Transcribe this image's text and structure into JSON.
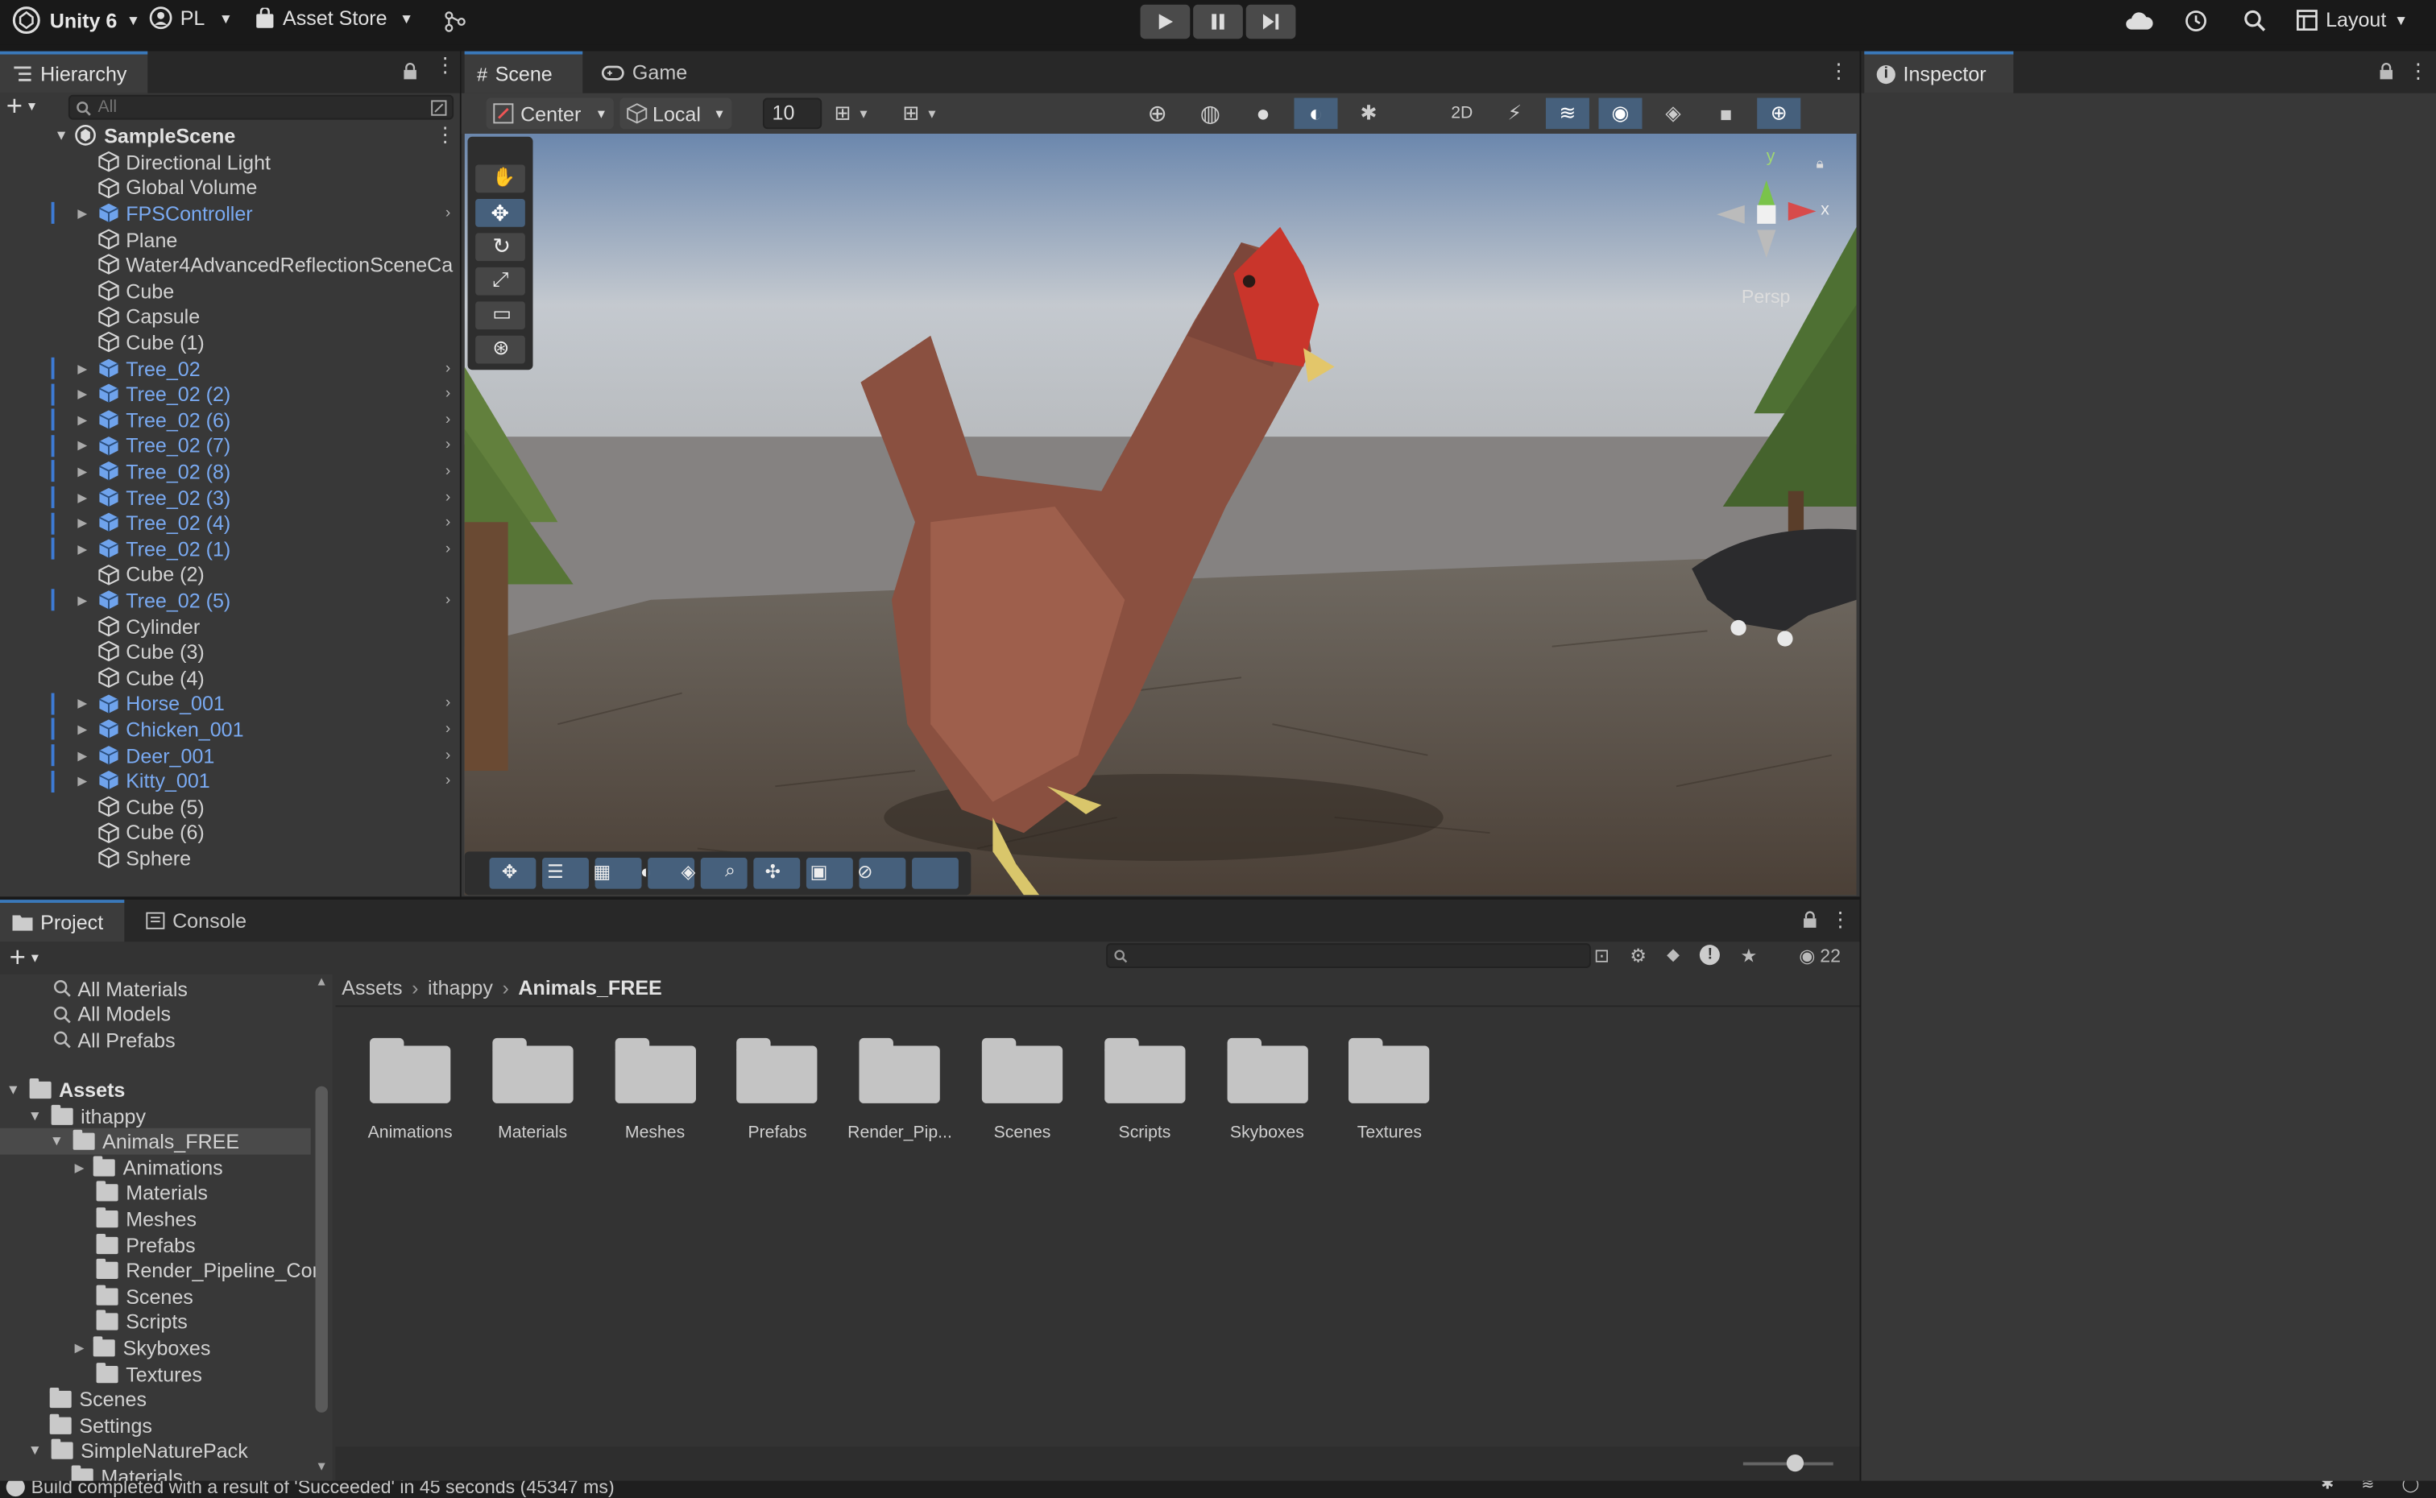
{
  "toolbar": {
    "app_name": "Unity 6",
    "account": "PL",
    "asset_store": "Asset Store",
    "layout": "Layout"
  },
  "hierarchy": {
    "tab": "Hierarchy",
    "search_placeholder": "All",
    "scene": "SampleScene",
    "items": [
      {
        "label": "Directional Light",
        "prefab": false,
        "expand": false
      },
      {
        "label": "Global Volume",
        "prefab": false,
        "expand": false
      },
      {
        "label": "FPSController",
        "prefab": true,
        "expand": true
      },
      {
        "label": "Plane",
        "prefab": false,
        "expand": false
      },
      {
        "label": "Water4AdvancedReflectionSceneCa",
        "prefab": false,
        "expand": false
      },
      {
        "label": "Cube",
        "prefab": false,
        "expand": false
      },
      {
        "label": "Capsule",
        "prefab": false,
        "expand": false
      },
      {
        "label": "Cube (1)",
        "prefab": false,
        "expand": false
      },
      {
        "label": "Tree_02",
        "prefab": true,
        "expand": true
      },
      {
        "label": "Tree_02 (2)",
        "prefab": true,
        "expand": true
      },
      {
        "label": "Tree_02 (6)",
        "prefab": true,
        "expand": true
      },
      {
        "label": "Tree_02 (7)",
        "prefab": true,
        "expand": true
      },
      {
        "label": "Tree_02 (8)",
        "prefab": true,
        "expand": true
      },
      {
        "label": "Tree_02 (3)",
        "prefab": true,
        "expand": true
      },
      {
        "label": "Tree_02 (4)",
        "prefab": true,
        "expand": true
      },
      {
        "label": "Tree_02 (1)",
        "prefab": true,
        "expand": true
      },
      {
        "label": "Cube (2)",
        "prefab": false,
        "expand": false
      },
      {
        "label": "Tree_02 (5)",
        "prefab": true,
        "expand": true
      },
      {
        "label": "Cylinder",
        "prefab": false,
        "expand": false
      },
      {
        "label": "Cube (3)",
        "prefab": false,
        "expand": false
      },
      {
        "label": "Cube (4)",
        "prefab": false,
        "expand": false
      },
      {
        "label": "Horse_001",
        "prefab": true,
        "expand": true
      },
      {
        "label": "Chicken_001",
        "prefab": true,
        "expand": true
      },
      {
        "label": "Deer_001",
        "prefab": true,
        "expand": true
      },
      {
        "label": "Kitty_001",
        "prefab": true,
        "expand": true
      },
      {
        "label": "Cube (5)",
        "prefab": false,
        "expand": false
      },
      {
        "label": "Cube (6)",
        "prefab": false,
        "expand": false
      },
      {
        "label": "Sphere",
        "prefab": false,
        "expand": false
      }
    ]
  },
  "scene_view": {
    "tab_scene": "Scene",
    "tab_game": "Game",
    "pivot": "Center",
    "space": "Local",
    "snap_value": "10",
    "gizmo_y": "y",
    "gizmo_x": "x",
    "persp": "Persp"
  },
  "inspector": {
    "tab": "Inspector"
  },
  "project": {
    "tab_project": "Project",
    "tab_console": "Console",
    "search_count": "22",
    "favorites": [
      "All Materials",
      "All Models",
      "All Prefabs"
    ],
    "tree": {
      "assets": "Assets",
      "ithappy": "ithappy",
      "animals": "Animals_FREE",
      "children": [
        "Animations",
        "Materials",
        "Meshes",
        "Prefabs",
        "Render_Pipeline_Con",
        "Scenes",
        "Scripts",
        "Skyboxes",
        "Textures"
      ],
      "scenes": "Scenes",
      "settings": "Settings",
      "nature": "SimpleNaturePack",
      "nature_child": "Materials"
    },
    "breadcrumb": [
      "Assets",
      "ithappy",
      "Animals_FREE"
    ],
    "folders": [
      "Animations",
      "Materials",
      "Meshes",
      "Prefabs",
      "Render_Pip...",
      "Scenes",
      "Scripts",
      "Skyboxes",
      "Textures"
    ]
  },
  "status": {
    "message": "Build completed with a result of 'Succeeded' in 45 seconds (45347 ms)"
  }
}
